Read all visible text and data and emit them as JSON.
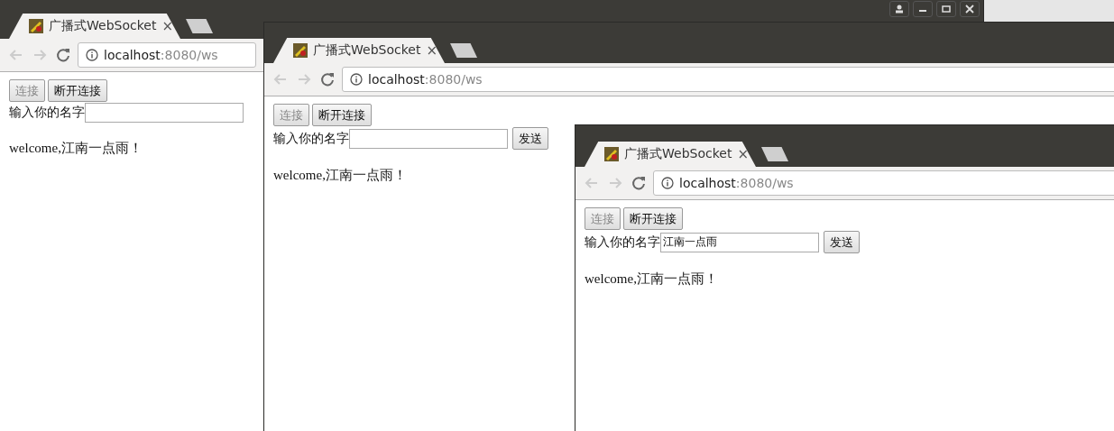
{
  "windows": [
    {
      "tab": {
        "title": "广播式WebSocket",
        "close": "×"
      },
      "window_controls": true,
      "url": {
        "host": "localhost",
        "path": ":8080/ws"
      },
      "connect_button": {
        "label": "连接",
        "disabled": true
      },
      "disconnect_button": {
        "label": "断开连接",
        "disabled": false
      },
      "name_label": "输入你的名字",
      "message": "welcome,江南一点雨！"
    },
    {
      "tab": {
        "title": "广播式WebSocket",
        "close": "×"
      },
      "window_controls": false,
      "url": {
        "host": "localhost",
        "path": ":8080/ws"
      },
      "connect_button": {
        "label": "连接",
        "disabled": true
      },
      "disconnect_button": {
        "label": "断开连接",
        "disabled": false
      },
      "name_label": "输入你的名字",
      "send_button": {
        "label": "发送"
      },
      "message": "welcome,江南一点雨！"
    },
    {
      "tab": {
        "title": "广播式WebSocket",
        "close": "×"
      },
      "window_controls": false,
      "url": {
        "host": "localhost",
        "path": ":8080/ws"
      },
      "connect_button": {
        "label": "连接",
        "disabled": true
      },
      "disconnect_button": {
        "label": "断开连接",
        "disabled": false
      },
      "name_label": "输入你的名字",
      "name_field": {
        "value": "江南一点雨"
      },
      "send_button": {
        "label": "发送"
      },
      "message": "welcome,江南一点雨！"
    }
  ]
}
